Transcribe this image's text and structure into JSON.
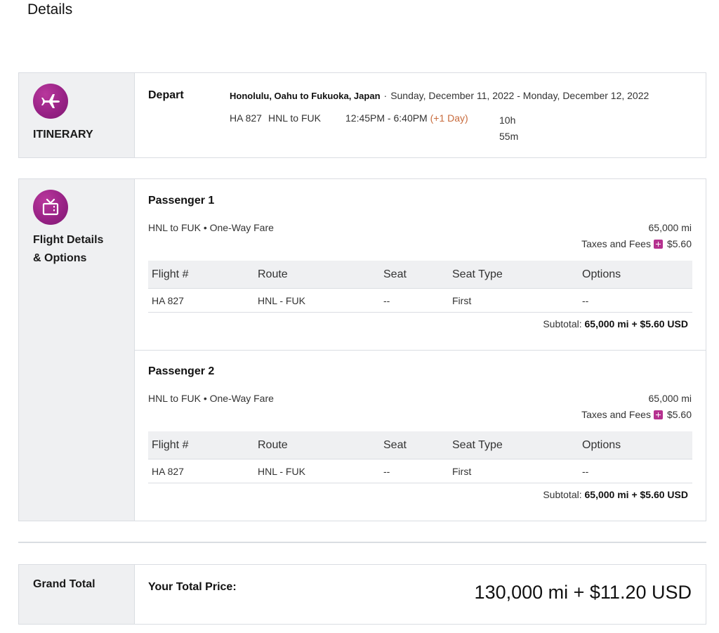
{
  "page_title": "Details",
  "itinerary": {
    "side_label": "ITINERARY",
    "icon": "plane-icon",
    "depart_label": "Depart",
    "route": "Honolulu, Oahu to Fukuoka, Japan",
    "dot": "·",
    "dates": "Sunday, December 11, 2022 - Monday, December 12, 2022",
    "flight_number": "HA 827",
    "segment": "HNL to FUK",
    "times": "12:45PM - 6:40PM",
    "plus_day": "(+1 Day)",
    "duration_hours": "10h",
    "duration_minutes": "55m"
  },
  "details": {
    "side_label_line1": "Flight Details",
    "side_label_line2": "& Options",
    "icon": "tv-icon",
    "columns": [
      "Flight #",
      "Route",
      "Seat",
      "Seat Type",
      "Options"
    ],
    "passengers": [
      {
        "title": "Passenger 1",
        "fare": "HNL to FUK • One-Way Fare",
        "miles": "65,000 mi",
        "fees_label": "Taxes and Fees",
        "fees_value": "$5.60",
        "row": [
          "HA 827",
          "HNL - FUK",
          "--",
          "First",
          "--"
        ],
        "subtotal_label": "Subtotal:",
        "subtotal_value": "65,000 mi + $5.60 USD"
      },
      {
        "title": "Passenger 2",
        "fare": "HNL to FUK • One-Way Fare",
        "miles": "65,000 mi",
        "fees_label": "Taxes and Fees",
        "fees_value": "$5.60",
        "row": [
          "HA 827",
          "HNL - FUK",
          "--",
          "First",
          "--"
        ],
        "subtotal_label": "Subtotal:",
        "subtotal_value": "65,000 mi + $5.60 USD"
      }
    ]
  },
  "grand_total": {
    "side_label": "Grand Total",
    "your_total_label": "Your Total Price:",
    "total_price": "130,000 mi + $11.20 USD"
  },
  "colors": {
    "accent": "#9b2687",
    "plus_day": "#c86b3c",
    "panel_side_bg": "#eff0f2"
  }
}
